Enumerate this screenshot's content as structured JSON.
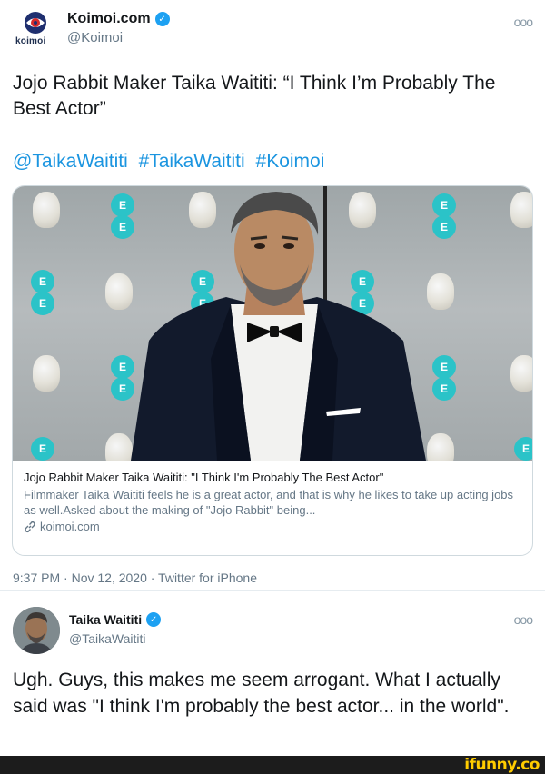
{
  "tweet": {
    "account": {
      "display_name": "Koimoi.com",
      "handle": "@Koimoi",
      "logo_text": "koimoi",
      "verified": true
    },
    "more_icon": "ooo",
    "text": "Jojo Rabbit Maker Taika Waititi: “I Think I’m Probably The Best Actor”",
    "hashtags": [
      "@TaikaWaititi",
      "#TaikaWaititi",
      "#Koimoi"
    ],
    "card": {
      "title": "Jojo Rabbit Maker Taika Waititi: \"I Think I'm Probably The Best Actor\"",
      "description": "Filmmaker Taika Waititi feels he is a great actor, and that is why he likes to take up acting jobs as well.Asked about the making of \"Jojo Rabbit\" being...",
      "domain": "koimoi.com"
    },
    "meta": "9:37 PM · Nov 12, 2020 · Twitter for iPhone"
  },
  "reply": {
    "display_name": "Taika Waititi",
    "handle": "@TaikaWaititi",
    "verified": true,
    "more_icon": "ooo",
    "text": "Ugh. Guys, this makes me seem arrogant. What I actually said was \"I think I'm probably the best actor... in the world\"."
  },
  "watermark": "ifunny.co",
  "colors": {
    "link": "#1b95e0",
    "verified": "#1da1f2",
    "secondary_text": "#657786",
    "watermark": "#ffcc00"
  }
}
